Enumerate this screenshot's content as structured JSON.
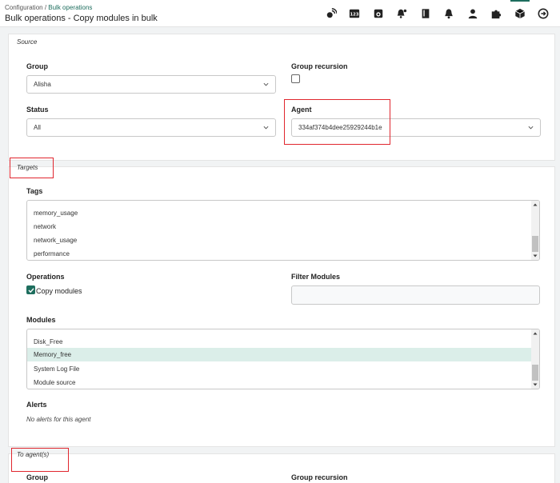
{
  "header": {
    "breadcrumb_root": "Configuration",
    "breadcrumb_sep": " / ",
    "breadcrumb_current": "Bulk operations",
    "title": "Bulk operations - Copy modules in bulk",
    "icons": [
      "satellite-icon",
      "counter-123-icon",
      "camera-icon",
      "bell-settings-icon",
      "book-icon",
      "bell-icon",
      "user-icon",
      "puzzle-icon",
      "cube-icon",
      "logout-icon"
    ]
  },
  "source": {
    "legend": "Source",
    "group_label": "Group",
    "group_value": "Alisha",
    "group_recursion_label": "Group recursion",
    "status_label": "Status",
    "status_value": "All",
    "agent_label": "Agent",
    "agent_value": "334af374b4dee25929244b1e"
  },
  "targets": {
    "legend": "Targets",
    "tags_label": "Tags",
    "tags": [
      "memory_usage",
      "network",
      "network_usage",
      "performance"
    ],
    "operations_label": "Operations",
    "copy_modules_label": "Copy modules",
    "filter_modules_label": "Filter Modules",
    "modules_label": "Modules",
    "modules": [
      "Disk_Free",
      "Memory_free",
      "System Log File",
      "Module source"
    ],
    "selected_module": "Memory_free",
    "alerts_label": "Alerts",
    "no_alerts_text": "No alerts for this agent"
  },
  "to_agents": {
    "legend": "To agent(s)",
    "group_label": "Group",
    "group_recursion_label": "Group recursion"
  },
  "colors": {
    "accent": "#1e6e5e",
    "highlight_box": "#e0262e",
    "selected_row": "#dbeee9"
  }
}
